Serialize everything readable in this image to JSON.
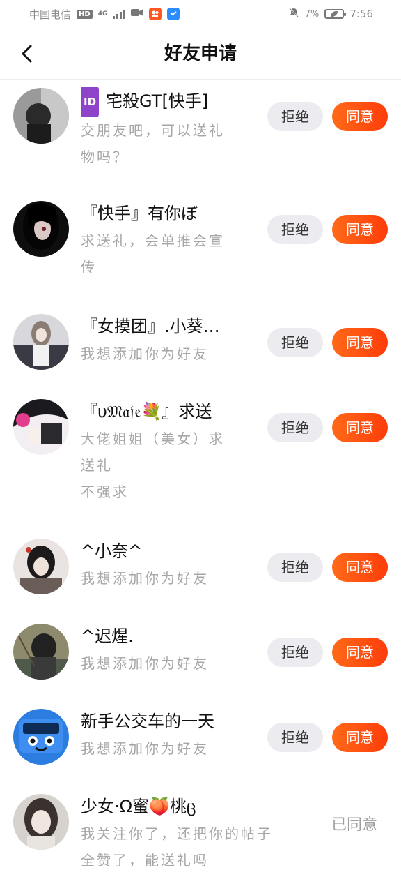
{
  "status_bar": {
    "carrier": "中国电信",
    "network_badge": "HD",
    "network_type": "4G",
    "battery_percent": "7%",
    "time": "7:56"
  },
  "nav": {
    "back_icon": "chevron-left-icon",
    "title": "好友申请"
  },
  "requests": [
    {
      "id_badge": "ID",
      "name": "宅殺GT[快手]",
      "message": "交朋友吧，可以送礼\n物吗？",
      "action": "pending"
    },
    {
      "name": "『快手』有你ぼ",
      "message": "求送礼，会单推会宣\n传",
      "action": "pending"
    },
    {
      "name": "『女摸团』.小葵…",
      "message": "我想添加你为好友",
      "action": "pending"
    },
    {
      "name": "『υ𝔐𝔞𝔣𝔢💐』求送",
      "message": "大佬姐姐（美女）求\n送礼\n不强求",
      "action": "pending"
    },
    {
      "name": "^小奈^",
      "message": "我想添加你为好友",
      "action": "pending"
    },
    {
      "name": "^迟煋.",
      "message": "我想添加你为好友",
      "action": "pending"
    },
    {
      "name": "新手公交车的一天",
      "message": "我想添加你为好友",
      "action": "pending"
    },
    {
      "name": "少女·Ω蜜🍑桃ც",
      "message": "我关注你了，还把你的帖子\n全赞了，能送礼吗",
      "action": "agreed"
    }
  ],
  "labels": {
    "reject": "拒绝",
    "agree": "同意",
    "agreed": "已同意"
  },
  "colors": {
    "agree_button": "#ff5a14",
    "reject_button": "#ebebf0",
    "id_badge": "#8e44c9"
  }
}
